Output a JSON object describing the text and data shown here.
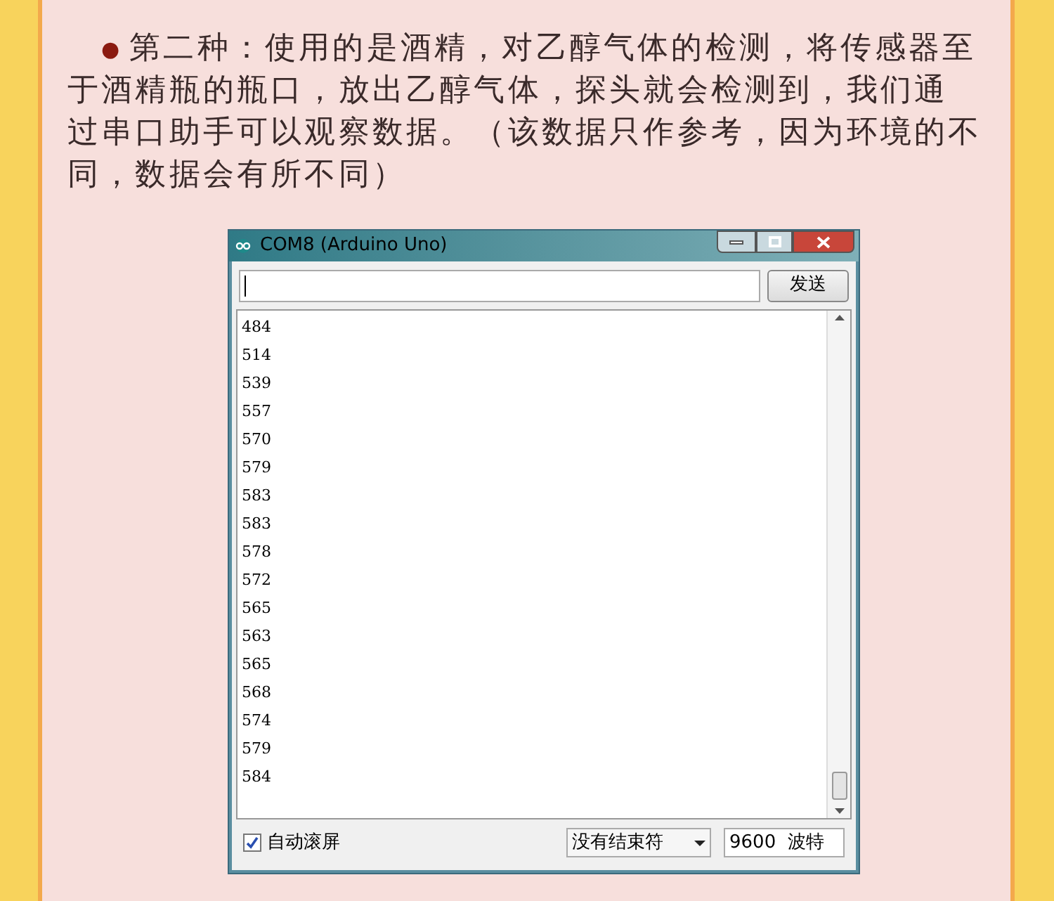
{
  "paragraph": {
    "bullet": "●",
    "lines": [
      "第二种：使用的是酒精，对乙醇气体的检测，将传感器至",
      "于酒精瓶的瓶口，放出乙醇气体，探头就会检测到，我们通",
      "过串口助手可以观察数据。（该数据只作参考，因为环境的不",
      "同，数据会有所不同）"
    ]
  },
  "serial_monitor": {
    "title": "COM8 (Arduino Uno)",
    "send_button": "发送",
    "output_lines": [
      "484",
      "514",
      "539",
      "557",
      "570",
      "579",
      "583",
      "583",
      "578",
      "572",
      "565",
      "563",
      "565",
      "568",
      "574",
      "579",
      "584"
    ],
    "autoscroll": {
      "label": "自动滚屏",
      "checked": true
    },
    "line_ending": "没有结束符",
    "baud_rate": "9600  波特"
  }
}
